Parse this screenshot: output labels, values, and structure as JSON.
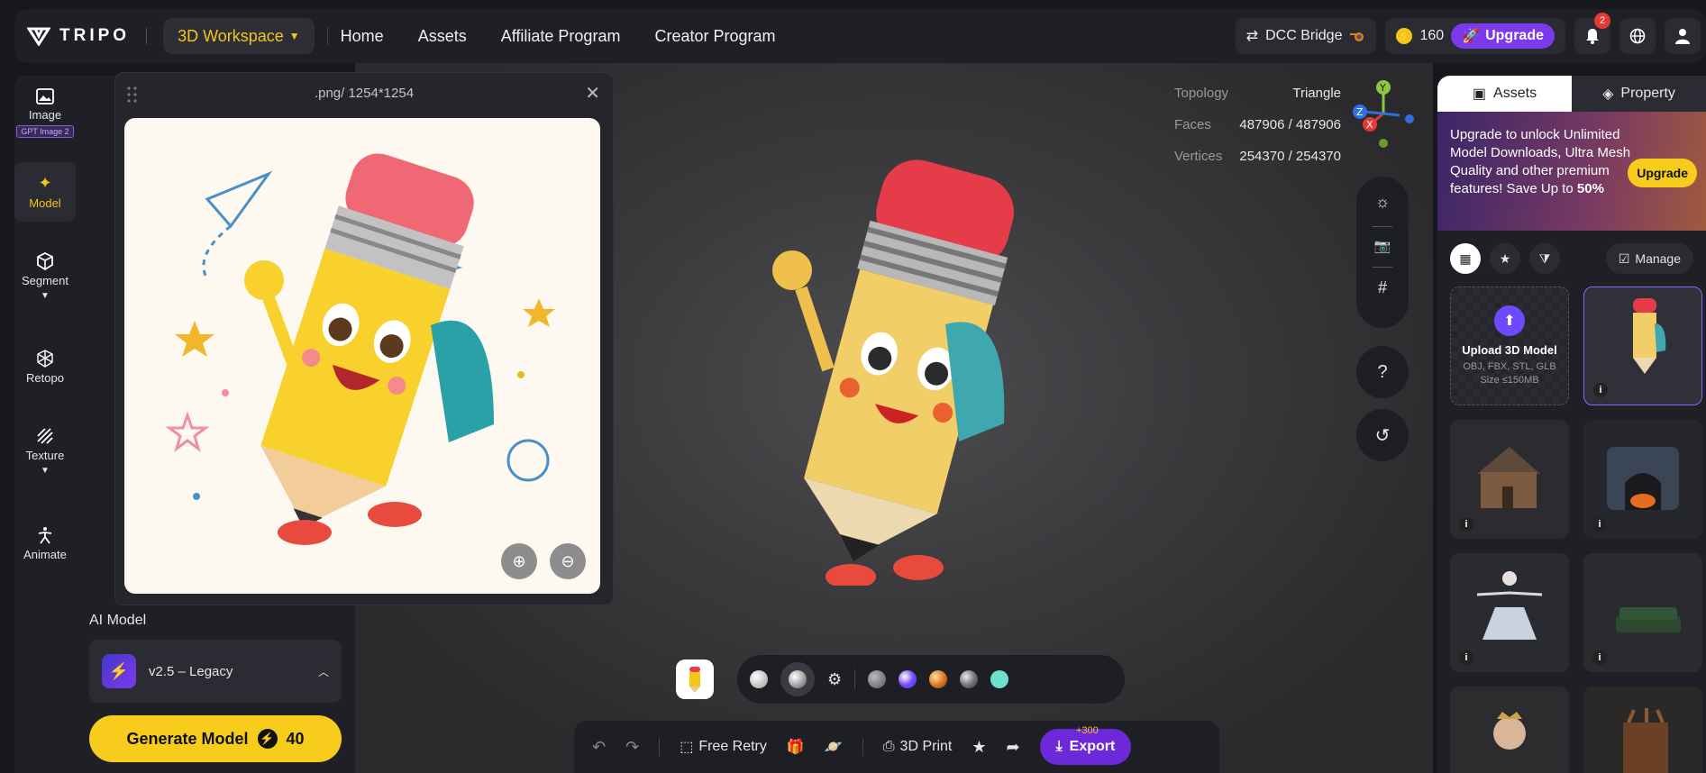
{
  "brand": {
    "name": "TRIPO"
  },
  "topnav": {
    "workspace": "3D Workspace",
    "links": [
      "Home",
      "Assets",
      "Affiliate Program",
      "Creator Program"
    ],
    "dcc_bridge": "DCC Bridge",
    "credits": "160",
    "upgrade": "Upgrade",
    "notifications_count": "2"
  },
  "rail": {
    "items": [
      {
        "label": "Image",
        "tag": "GPT Image 2"
      },
      {
        "label": "Model"
      },
      {
        "label": "Segment"
      },
      {
        "label": "Retopo"
      },
      {
        "label": "Texture"
      },
      {
        "label": "Animate"
      }
    ]
  },
  "genpanel": {
    "ai_model_label": "AI Model",
    "model_value": "v2.5 – Legacy",
    "generate_label": "Generate Model",
    "generate_cost": "40"
  },
  "popup": {
    "title": ".png/ 1254*1254"
  },
  "stats": {
    "topology_label": "Topology",
    "topology_value": "Triangle",
    "faces_label": "Faces",
    "faces_value": "487906 / 487906",
    "vertices_label": "Vertices",
    "vertices_value": "254370 / 254370"
  },
  "materials": {
    "colors": [
      "#c9c9c9",
      "#ffffff",
      "#8e8e8e",
      "#7c4dff",
      "#e07b28",
      "#a0a0a0",
      "#6ee0d2"
    ]
  },
  "actions": {
    "free_retry": "Free Retry",
    "print": "3D Print",
    "bonus": "+300",
    "export": "Export"
  },
  "rpanel": {
    "tab_assets": "Assets",
    "tab_property": "Property",
    "promo_text": "Upgrade to unlock Unlimited Model Downloads, Ultra Mesh Quality and other premium features!  Save Up to ",
    "promo_pct": "50%",
    "promo_btn": "Upgrade",
    "manage": "Manage",
    "upload_title": "Upload 3D Model",
    "upload_formats": "OBJ, FBX, STL, GLB",
    "upload_size": "Size ≤150MB"
  }
}
